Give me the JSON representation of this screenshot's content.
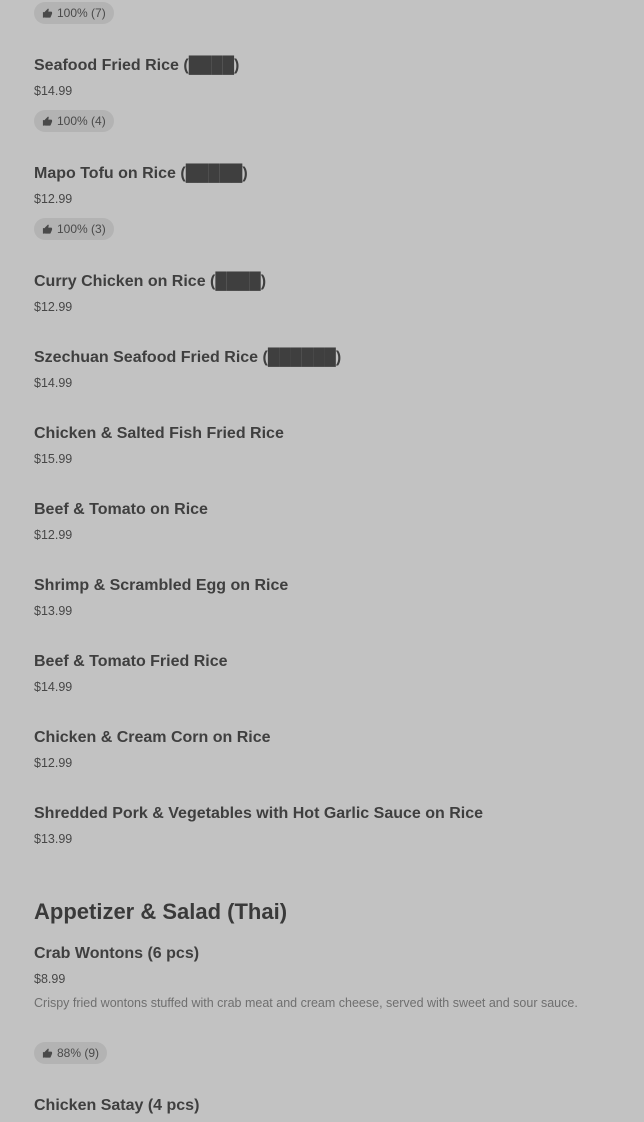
{
  "top_badge": {
    "rating": "100% (7)"
  },
  "items": [
    {
      "name": "Seafood Fried Rice (████)",
      "price": "$14.99",
      "badge": "100% (4)"
    },
    {
      "name": "Mapo Tofu on Rice (█████)",
      "price": "$12.99",
      "badge": "100% (3)"
    },
    {
      "name": "Curry Chicken on Rice (████)",
      "price": "$12.99"
    },
    {
      "name": "Szechuan Seafood Fried Rice (██████)",
      "price": "$14.99"
    },
    {
      "name": "Chicken & Salted Fish Fried Rice",
      "price": "$15.99"
    },
    {
      "name": "Beef & Tomato on Rice",
      "price": "$12.99"
    },
    {
      "name": "Shrimp & Scrambled Egg on Rice",
      "price": "$13.99"
    },
    {
      "name": "Beef & Tomato Fried Rice",
      "price": "$14.99"
    },
    {
      "name": "Chicken & Cream Corn on Rice",
      "price": "$12.99"
    },
    {
      "name": "Shredded Pork & Vegetables with Hot Garlic Sauce on Rice",
      "price": "$13.99"
    }
  ],
  "section": {
    "title": "Appetizer & Salad (Thai)",
    "items": [
      {
        "name": "Crab Wontons (6 pcs)",
        "price": "$8.99",
        "description": "Crispy fried wontons stuffed with crab meat and cream cheese, served with sweet and sour sauce.",
        "badge": "88% (9)"
      },
      {
        "name": "Chicken Satay (4 pcs)"
      }
    ]
  }
}
